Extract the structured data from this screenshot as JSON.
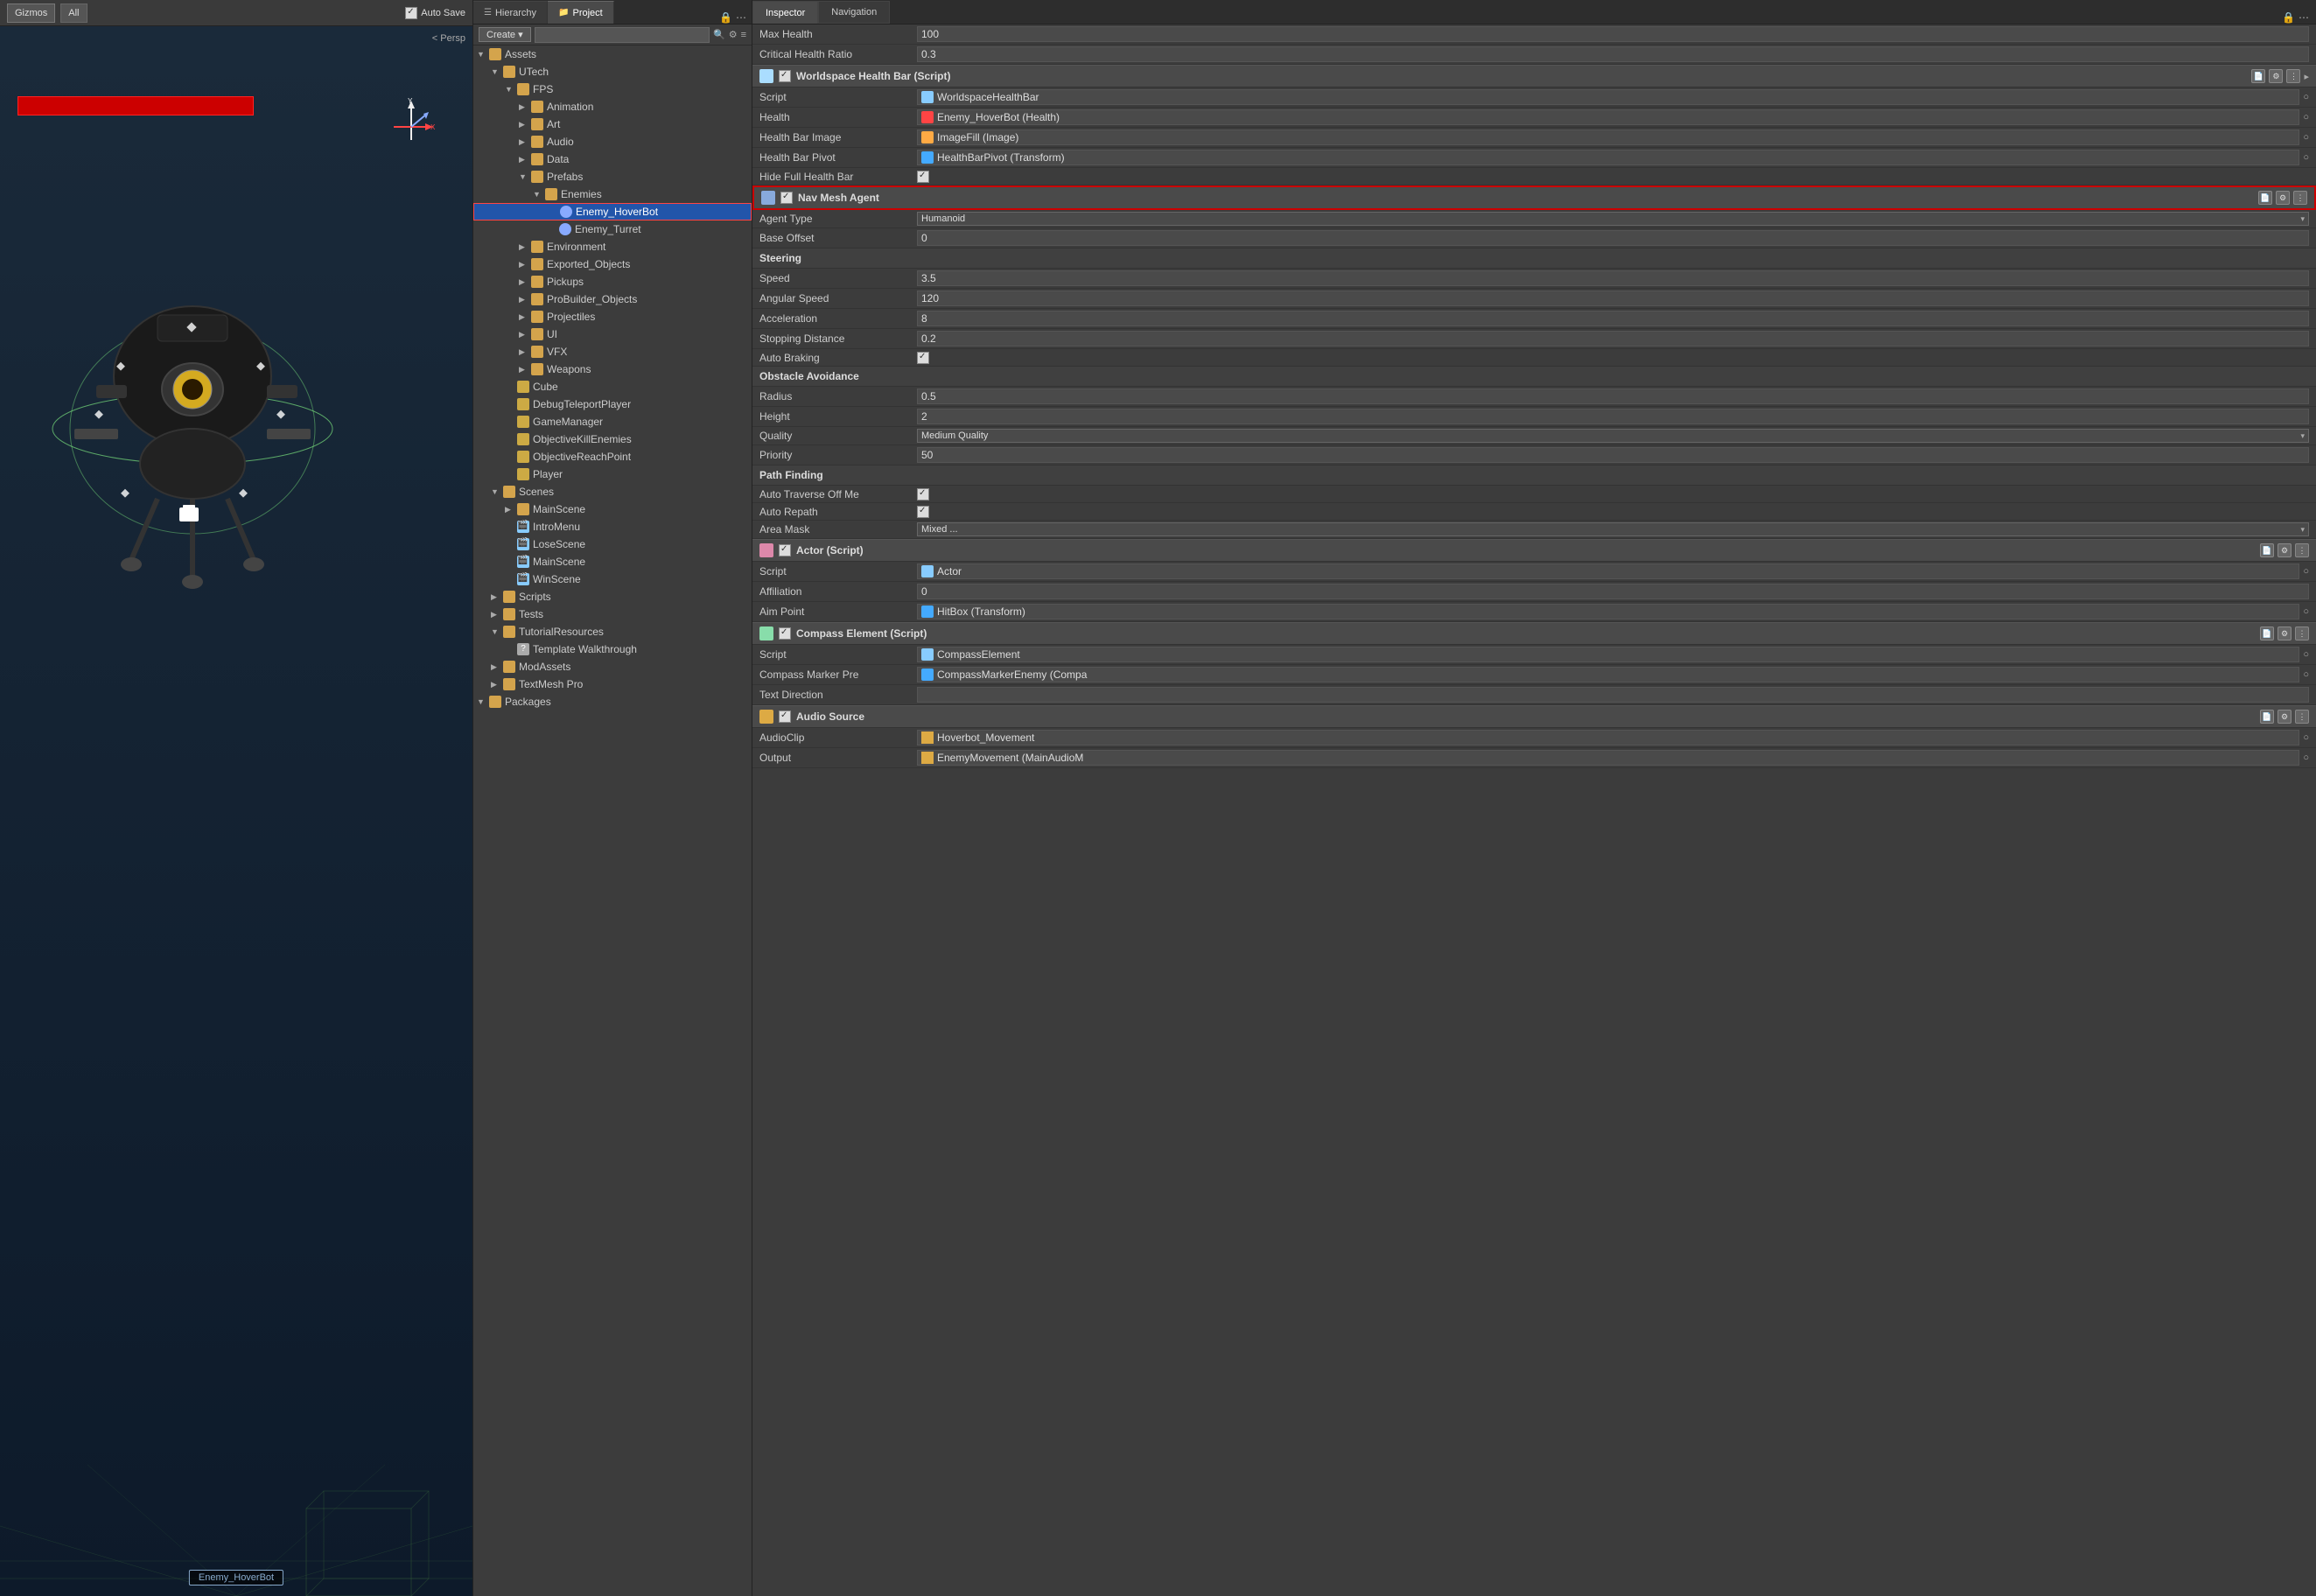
{
  "scene": {
    "toolbar": {
      "gizmos_label": "Gizmos",
      "all_label": "All",
      "auto_save_label": "Auto Save"
    },
    "persp_label": "< Persp",
    "object_label": "Enemy_HoverBot"
  },
  "tabs": {
    "hierarchy_label": "Hierarchy",
    "project_label": "Project",
    "project_active": true
  },
  "project": {
    "create_label": "Create ▾",
    "search_placeholder": "",
    "tree": [
      {
        "id": "assets",
        "label": "Assets",
        "indent": 0,
        "type": "folder",
        "expanded": true
      },
      {
        "id": "utech",
        "label": "UTech",
        "indent": 1,
        "type": "folder",
        "expanded": true
      },
      {
        "id": "fps",
        "label": "FPS",
        "indent": 2,
        "type": "folder",
        "expanded": true
      },
      {
        "id": "animation",
        "label": "Animation",
        "indent": 3,
        "type": "folder"
      },
      {
        "id": "art",
        "label": "Art",
        "indent": 3,
        "type": "folder"
      },
      {
        "id": "audio",
        "label": "Audio",
        "indent": 3,
        "type": "folder"
      },
      {
        "id": "data",
        "label": "Data",
        "indent": 3,
        "type": "folder"
      },
      {
        "id": "prefabs",
        "label": "Prefabs",
        "indent": 3,
        "type": "folder",
        "expanded": true
      },
      {
        "id": "enemies",
        "label": "Enemies",
        "indent": 4,
        "type": "folder",
        "expanded": true
      },
      {
        "id": "enemy_hoverbot",
        "label": "Enemy_HoverBot",
        "indent": 5,
        "type": "prefab",
        "selected": true
      },
      {
        "id": "enemy_turret",
        "label": "Enemy_Turret",
        "indent": 5,
        "type": "prefab"
      },
      {
        "id": "environment",
        "label": "Environment",
        "indent": 3,
        "type": "folder"
      },
      {
        "id": "exported_objects",
        "label": "Exported_Objects",
        "indent": 3,
        "type": "folder"
      },
      {
        "id": "pickups",
        "label": "Pickups",
        "indent": 3,
        "type": "folder"
      },
      {
        "id": "probuilder_objects",
        "label": "ProBuilder_Objects",
        "indent": 3,
        "type": "folder"
      },
      {
        "id": "projectiles",
        "label": "Projectiles",
        "indent": 3,
        "type": "folder"
      },
      {
        "id": "ui",
        "label": "UI",
        "indent": 3,
        "type": "folder"
      },
      {
        "id": "vfx",
        "label": "VFX",
        "indent": 3,
        "type": "folder"
      },
      {
        "id": "weapons",
        "label": "Weapons",
        "indent": 3,
        "type": "folder"
      },
      {
        "id": "cube",
        "label": "Cube",
        "indent": 2,
        "type": "asset"
      },
      {
        "id": "debugteleportplayer",
        "label": "DebugTeleportPlayer",
        "indent": 2,
        "type": "asset"
      },
      {
        "id": "gamemanager",
        "label": "GameManager",
        "indent": 2,
        "type": "asset"
      },
      {
        "id": "objectivekillenemies",
        "label": "ObjectiveKillEnemies",
        "indent": 2,
        "type": "asset"
      },
      {
        "id": "objectivereachpoint",
        "label": "ObjectiveReachPoint",
        "indent": 2,
        "type": "asset"
      },
      {
        "id": "player",
        "label": "Player",
        "indent": 2,
        "type": "asset"
      },
      {
        "id": "scenes",
        "label": "Scenes",
        "indent": 1,
        "type": "folder",
        "expanded": true
      },
      {
        "id": "mainscene",
        "label": "MainScene",
        "indent": 2,
        "type": "folder"
      },
      {
        "id": "intromenu",
        "label": "IntroMenu",
        "indent": 2,
        "type": "scene"
      },
      {
        "id": "losescene",
        "label": "LoseScene",
        "indent": 2,
        "type": "scene"
      },
      {
        "id": "mainscene2",
        "label": "MainScene",
        "indent": 2,
        "type": "scene"
      },
      {
        "id": "winscene",
        "label": "WinScene",
        "indent": 2,
        "type": "scene"
      },
      {
        "id": "scripts",
        "label": "Scripts",
        "indent": 1,
        "type": "folder"
      },
      {
        "id": "tests",
        "label": "Tests",
        "indent": 1,
        "type": "folder"
      },
      {
        "id": "tutorialresources",
        "label": "TutorialResources",
        "indent": 1,
        "type": "folder",
        "expanded": true
      },
      {
        "id": "template_walkthrough",
        "label": "Template Walkthrough",
        "indent": 2,
        "type": "asset_question"
      },
      {
        "id": "modassets",
        "label": "ModAssets",
        "indent": 1,
        "type": "folder"
      },
      {
        "id": "textmeshpro",
        "label": "TextMesh Pro",
        "indent": 1,
        "type": "folder"
      },
      {
        "id": "packages",
        "label": "Packages",
        "indent": 0,
        "type": "folder",
        "expanded": true
      }
    ]
  },
  "inspector": {
    "tabs": [
      "Inspector",
      "Navigation"
    ],
    "active_tab": "Inspector",
    "sections": {
      "health_component": {
        "rows": [
          {
            "label": "Max Health",
            "value": "100",
            "type": "text"
          },
          {
            "label": "Critical Health Ratio",
            "value": "0.3",
            "type": "text"
          }
        ]
      },
      "worldspace_healthbar": {
        "title": "Worldspace Health Bar (Script)",
        "enabled": true,
        "rows": [
          {
            "label": "Script",
            "value": "WorldspaceHealthBar",
            "type": "script"
          },
          {
            "label": "Health",
            "value": "Enemy_HoverBot (Health)",
            "type": "ref_health"
          },
          {
            "label": "Health Bar Image",
            "value": "ImageFill (Image)",
            "type": "ref_image"
          },
          {
            "label": "Health Bar Pivot",
            "value": "HealthBarPivot (Transform)",
            "type": "ref_transform"
          },
          {
            "label": "Hide Full Health Bar",
            "value": "",
            "type": "checkbox_checked"
          }
        ]
      },
      "navmesh_agent": {
        "title": "Nav Mesh Agent",
        "enabled": true,
        "highlighted": true,
        "rows": [
          {
            "label": "Agent Type",
            "value": "Humanoid",
            "type": "dropdown"
          },
          {
            "label": "Base Offset",
            "value": "0",
            "type": "text"
          }
        ],
        "steering_label": "Steering",
        "steering_rows": [
          {
            "label": "Speed",
            "value": "3.5",
            "type": "text"
          },
          {
            "label": "Angular Speed",
            "value": "120",
            "type": "text"
          },
          {
            "label": "Acceleration",
            "value": "8",
            "type": "text"
          },
          {
            "label": "Stopping Distance",
            "value": "0.2",
            "type": "text"
          },
          {
            "label": "Auto Braking",
            "value": "",
            "type": "checkbox_checked"
          }
        ],
        "obstacle_label": "Obstacle Avoidance",
        "obstacle_rows": [
          {
            "label": "Radius",
            "value": "0.5",
            "type": "text"
          },
          {
            "label": "Height",
            "value": "2",
            "type": "text"
          },
          {
            "label": "Quality",
            "value": "Medium Quality",
            "type": "dropdown"
          },
          {
            "label": "Priority",
            "value": "50",
            "type": "text"
          }
        ],
        "pathfinding_label": "Path Finding",
        "pathfinding_rows": [
          {
            "label": "Auto Traverse Off Me",
            "value": "",
            "type": "checkbox_checked"
          },
          {
            "label": "Auto Repath",
            "value": "",
            "type": "checkbox_checked"
          },
          {
            "label": "Area Mask",
            "value": "Mixed ...",
            "type": "dropdown"
          }
        ]
      },
      "actor": {
        "title": "Actor (Script)",
        "enabled": true,
        "rows": [
          {
            "label": "Script",
            "value": "Actor",
            "type": "script"
          },
          {
            "label": "Affiliation",
            "value": "0",
            "type": "text"
          },
          {
            "label": "Aim Point",
            "value": "HitBox (Transform)",
            "type": "ref_transform"
          }
        ]
      },
      "compass_element": {
        "title": "Compass Element (Script)",
        "enabled": true,
        "rows": [
          {
            "label": "Script",
            "value": "CompassElement",
            "type": "script"
          },
          {
            "label": "Compass Marker Pre",
            "value": "CompassMarkerEnemy (Compa",
            "type": "ref"
          },
          {
            "label": "Text Direction",
            "value": "",
            "type": "text"
          }
        ]
      },
      "audio_source": {
        "title": "Audio Source",
        "enabled": true,
        "rows": [
          {
            "label": "AudioClip",
            "value": "Hoverbot_Movement",
            "type": "ref_audio"
          },
          {
            "label": "Output",
            "value": "EnemyMovement (MainAudioM",
            "type": "ref"
          }
        ]
      }
    }
  }
}
